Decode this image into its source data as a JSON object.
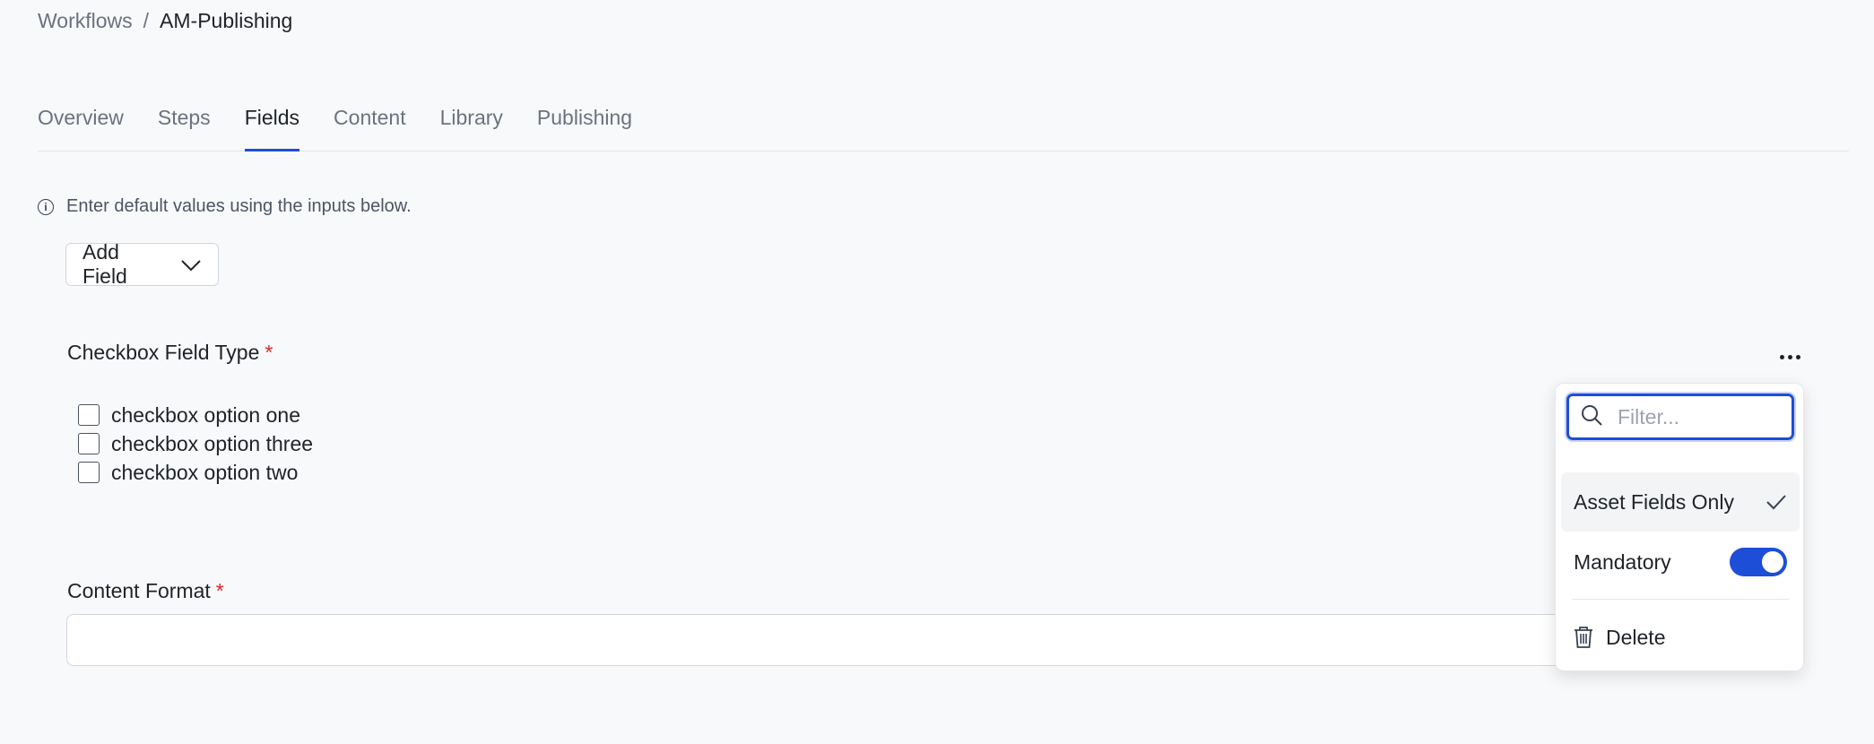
{
  "breadcrumb": {
    "parent": "Workflows",
    "separator": "/",
    "current": "AM-Publishing"
  },
  "tabs": [
    {
      "label": "Overview"
    },
    {
      "label": "Steps"
    },
    {
      "label": "Fields",
      "active": true
    },
    {
      "label": "Content"
    },
    {
      "label": "Library"
    },
    {
      "label": "Publishing"
    }
  ],
  "info": {
    "text": "Enter default values using the inputs below.",
    "icon": "info-icon"
  },
  "add_field": {
    "label": "Add Field",
    "icon": "chevron-down-icon"
  },
  "fields": [
    {
      "label": "Checkbox Field Type",
      "required_mark": "*",
      "options": [
        "checkbox option one",
        "checkbox option three",
        "checkbox option two"
      ]
    },
    {
      "label": "Content Format",
      "required_mark": "*",
      "value": ""
    }
  ],
  "menu": {
    "filter_placeholder": "Filter...",
    "asset_fields_only": "Asset Fields Only",
    "mandatory": "Mandatory",
    "mandatory_on": true,
    "delete": "Delete"
  },
  "colors": {
    "accent": "#1d4ed8",
    "required": "#dc2626",
    "background": "#f8f9fb"
  }
}
